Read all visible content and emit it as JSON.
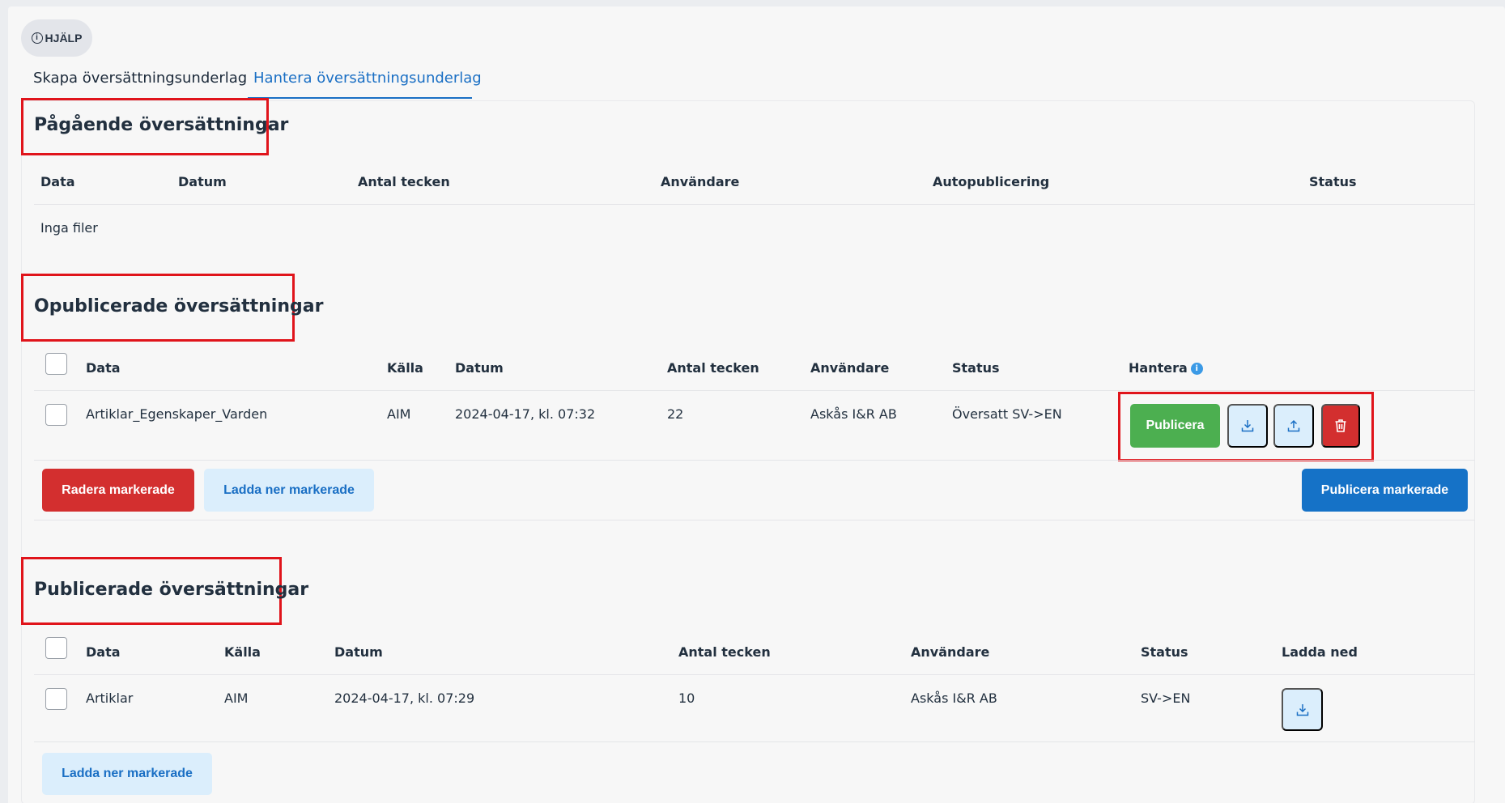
{
  "help": {
    "label": "HJÄLP"
  },
  "tabs": [
    {
      "label": "Skapa översättningsunderlag"
    },
    {
      "label": "Hantera översättningsunderlag"
    }
  ],
  "ongoing": {
    "title": "Pågående översättningar",
    "headers": [
      "Data",
      "Datum",
      "Antal tecken",
      "Användare",
      "Autopublicering",
      "Status"
    ],
    "empty_text": "Inga filer"
  },
  "unpublished": {
    "title": "Opublicerade översättningar",
    "headers": [
      "Data",
      "Källa",
      "Datum",
      "Antal tecken",
      "Användare",
      "Status",
      "Hantera"
    ],
    "rows": [
      {
        "data": "Artiklar_Egenskaper_Varden",
        "kalla": "AIM",
        "datum": "2024-04-17, kl. 07:32",
        "antal": "22",
        "anvandare": "Askås I&R AB",
        "status": "Översatt SV->EN"
      }
    ],
    "publish_label": "Publicera",
    "delete_selected": "Radera markerade",
    "download_selected": "Ladda ner markerade",
    "publish_selected": "Publicera markerade"
  },
  "published": {
    "title": "Publicerade översättningar",
    "headers": [
      "Data",
      "Källa",
      "Datum",
      "Antal tecken",
      "Användare",
      "Status",
      "Ladda ned"
    ],
    "rows": [
      {
        "data": "Artiklar",
        "kalla": "AIM",
        "datum": "2024-04-17, kl. 07:29",
        "antal": "10",
        "anvandare": "Askås I&R AB",
        "status": "SV->EN"
      }
    ],
    "download_selected": "Ladda ner markerade"
  },
  "colors": {
    "accent": "#1572c7",
    "danger": "#d32f2f",
    "success": "#4caf50",
    "highlight": "#e0141b"
  }
}
